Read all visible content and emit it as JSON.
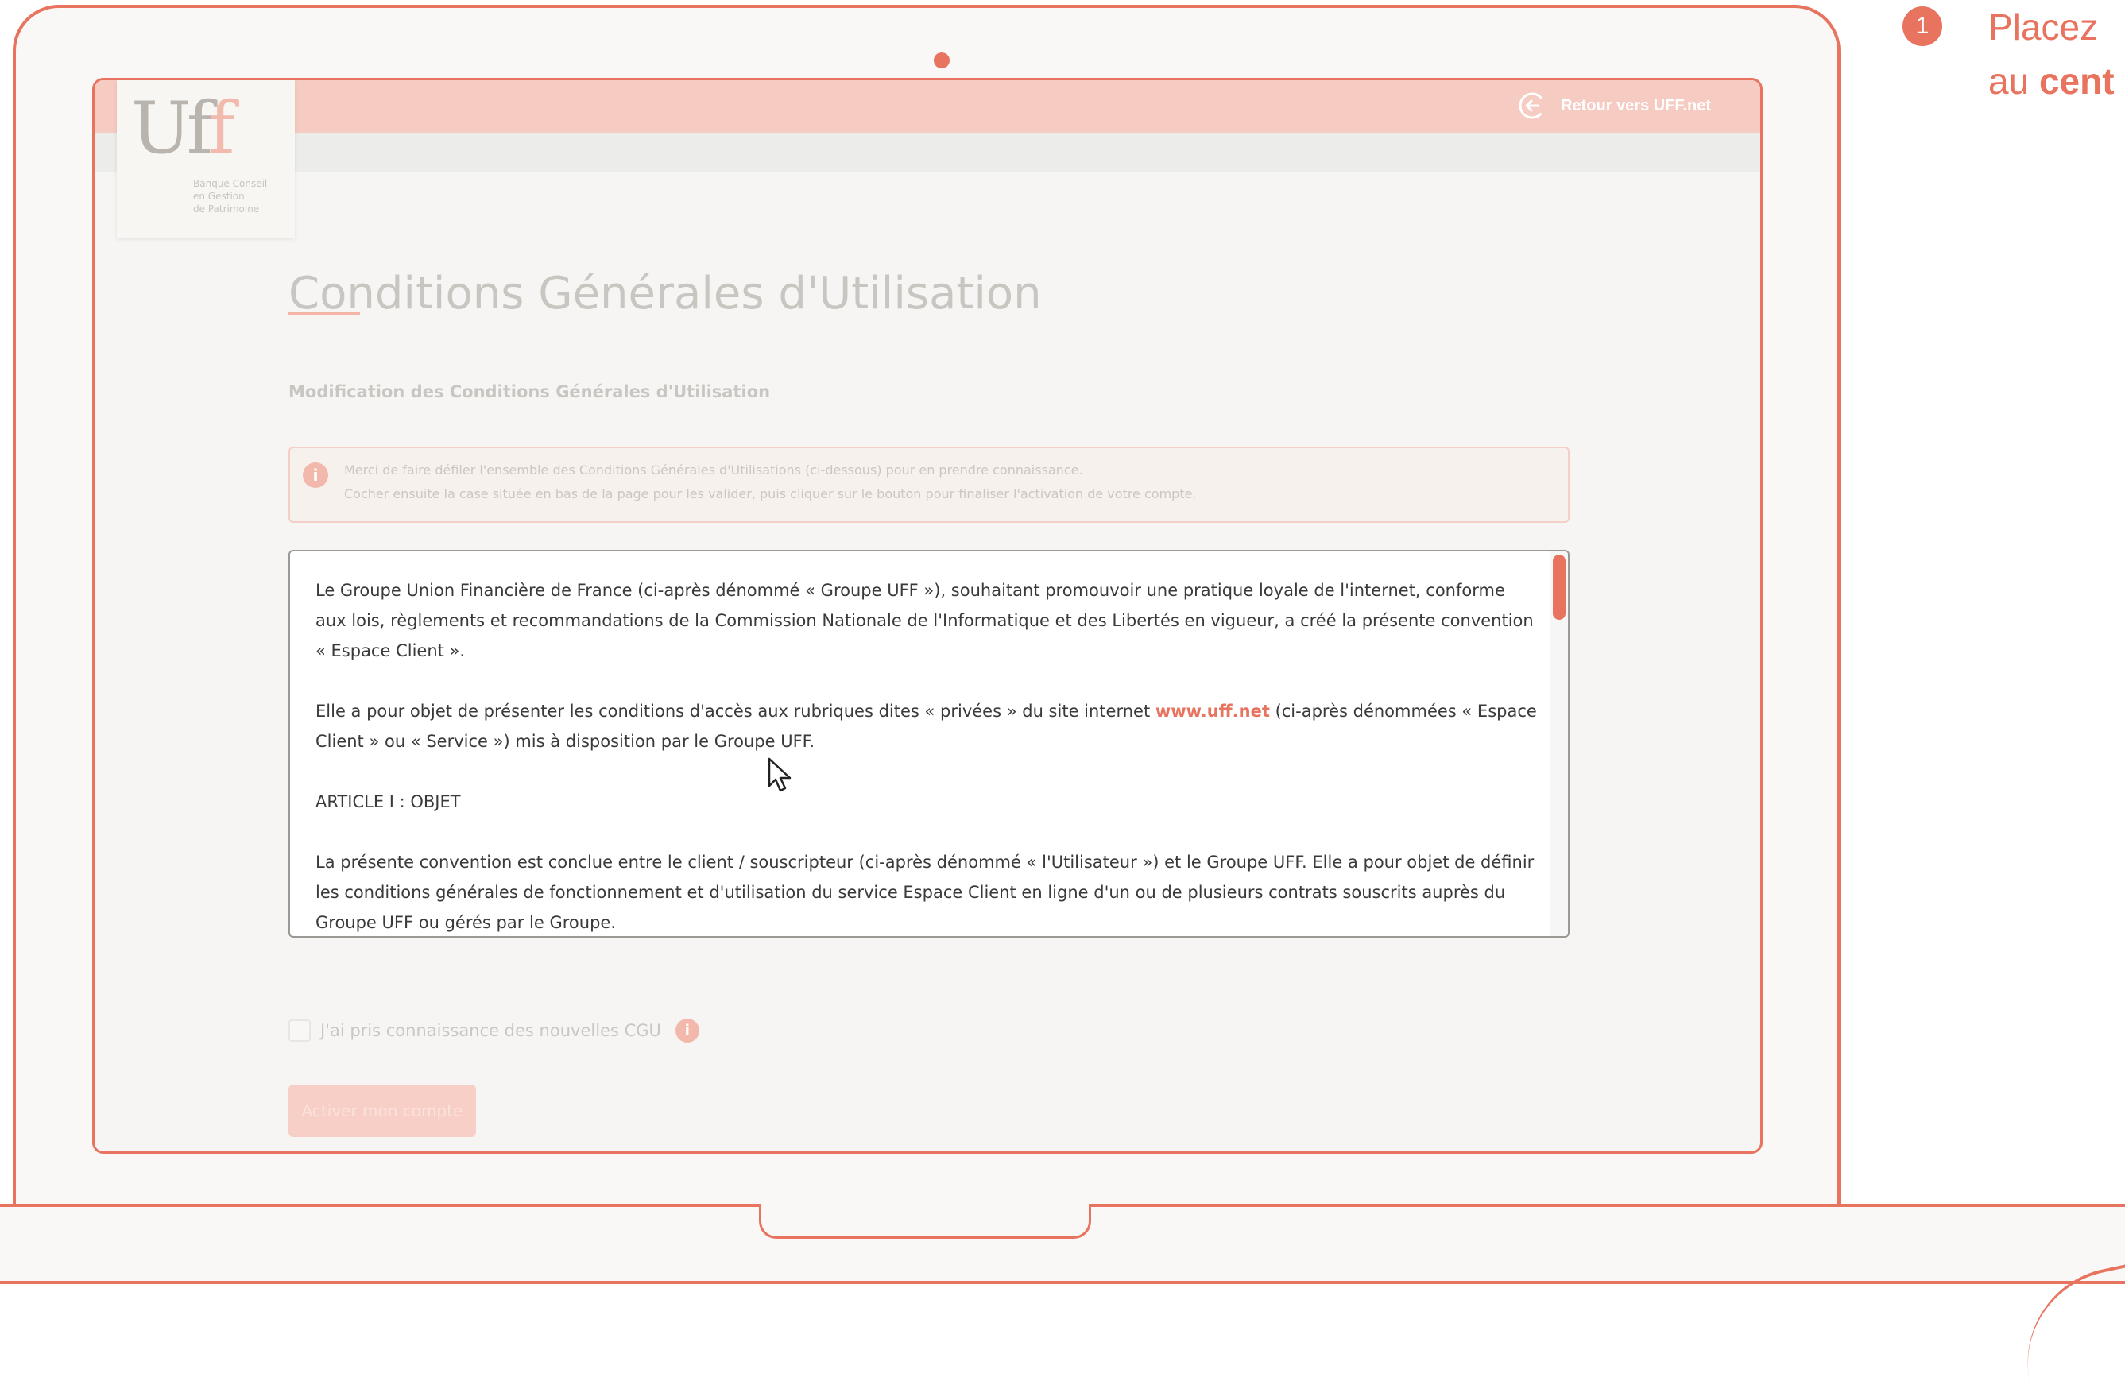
{
  "header": {
    "back_label": "Retour vers UFF.net"
  },
  "logo": {
    "mark_u": "U",
    "mark_f1": "f",
    "mark_f2": "f",
    "tagline": "Banque Conseil\nen Gestion\nde Patrimoine"
  },
  "page": {
    "title": "Conditions Générales d'Utilisation",
    "section_heading": "Modification des Conditions Générales d'Utilisation"
  },
  "info": {
    "line1": "Merci de faire défiler l'ensemble des Conditions Générales d'Utilisations (ci-dessous) pour en prendre connaissance.",
    "line2": "Cocher ensuite la case située en bas de la page pour les valider, puis cliquer sur le bouton pour finaliser l'activation de votre compte."
  },
  "terms": {
    "p1": "Le Groupe Union Financière de France (ci-après dénommé « Groupe UFF »), souhaitant promouvoir une pratique loyale de l'internet, conforme aux lois, règlements et recommandations de la Commission Nationale de l'Informatique et des Libertés en vigueur, a créé la présente convention « Espace Client ».",
    "p2_before": "Elle a pour objet de présenter les conditions d'accès aux rubriques dites « privées » du site internet ",
    "p2_link": "www.uff.net",
    "p2_after": " (ci-après dénommées « Espace Client » ou « Service ») mis à disposition par le Groupe UFF.",
    "p3": "ARTICLE I : OBJET",
    "p4": "La présente convention est conclue entre le client / souscripteur (ci-après dénommé « l'Utilisateur ») et le Groupe UFF. Elle a pour objet de définir les conditions générales de fonctionnement et d'utilisation du service Espace Client en ligne d'un ou de plusieurs contrats souscrits auprès du Groupe UFF ou gérés par le Groupe."
  },
  "consent": {
    "checkbox_label": "J'ai pris connaissance des nouvelles CGU",
    "checked": false,
    "info_icon": "i"
  },
  "actions": {
    "activate_label": "Activer mon compte"
  },
  "tutorial": {
    "step_number": "1",
    "line1": "Placez",
    "line2_prefix": "au ",
    "line2_bold": "cent"
  },
  "colors": {
    "accent": "#e8735e",
    "header_bg": "#f6cbc2"
  }
}
